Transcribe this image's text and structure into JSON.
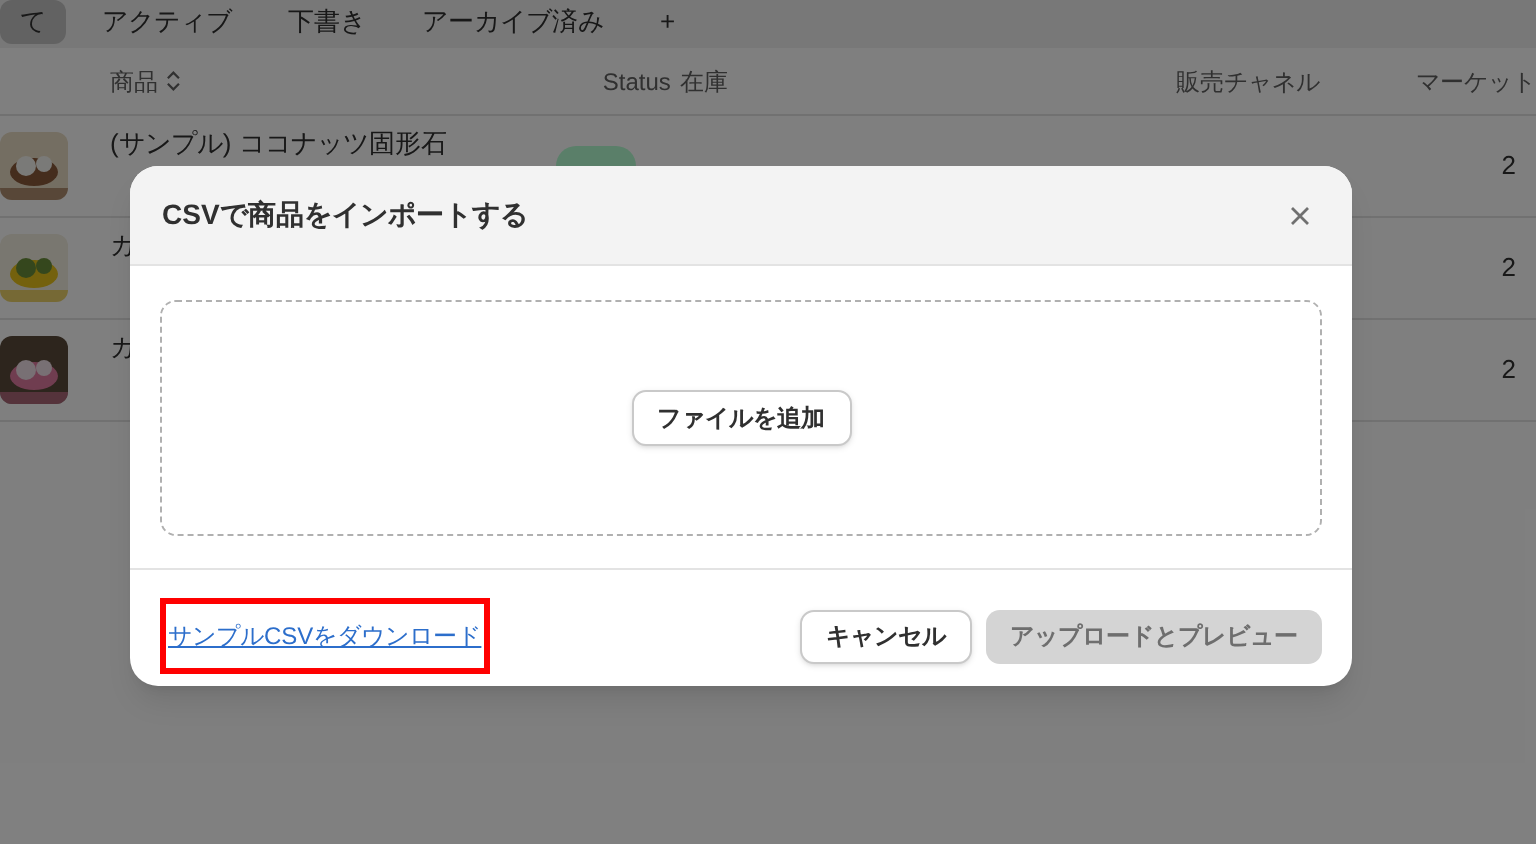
{
  "tabs": [
    {
      "label": "て",
      "selected": true
    },
    {
      "label": "アクティブ",
      "selected": false
    },
    {
      "label": "下書き",
      "selected": false
    },
    {
      "label": "アーカイブ済み",
      "selected": false
    },
    {
      "label": "+",
      "selected": false
    }
  ],
  "table": {
    "columns": [
      "商品",
      "Status",
      "在庫",
      "販売チャネル",
      "マーケット"
    ],
    "rows": [
      {
        "name": "(サンプル) ココナッツ固形石",
        "market": "2"
      },
      {
        "name": "カ",
        "market": "2"
      },
      {
        "name": "カ",
        "market": "2"
      }
    ]
  },
  "dialog": {
    "title": "CSVで商品をインポートする",
    "add_file_button": "ファイルを追加",
    "sample_link": "サンプルCSVをダウンロード",
    "cancel_button": "キャンセル",
    "upload_button": {
      "label": "アップロードとプレビュー",
      "disabled": true
    }
  }
}
